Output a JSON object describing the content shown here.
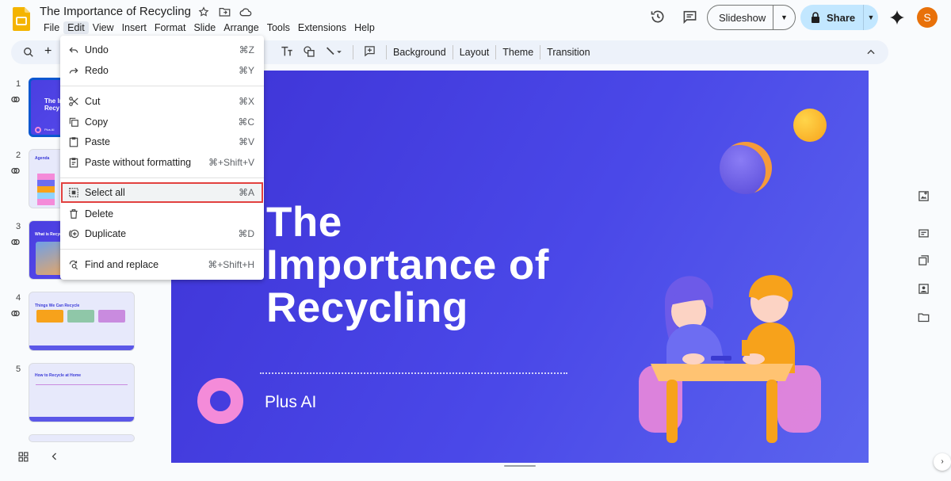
{
  "document": {
    "title": "The Importance of Recycling"
  },
  "menu": [
    "File",
    "Edit",
    "View",
    "Insert",
    "Format",
    "Slide",
    "Arrange",
    "Tools",
    "Extensions",
    "Help"
  ],
  "header": {
    "slideshow_label": "Slideshow",
    "share_label": "Share",
    "avatar_letter": "S"
  },
  "toolbar": {
    "background": "Background",
    "layout": "Layout",
    "theme": "Theme",
    "transition": "Transition"
  },
  "edit_menu": {
    "items": [
      {
        "label": "Undo",
        "shortcut": "⌘Z",
        "icon": "undo-icon"
      },
      {
        "label": "Redo",
        "shortcut": "⌘Y",
        "icon": "redo-icon"
      },
      {
        "label": "Cut",
        "shortcut": "⌘X",
        "icon": "cut-icon"
      },
      {
        "label": "Copy",
        "shortcut": "⌘C",
        "icon": "copy-icon"
      },
      {
        "label": "Paste",
        "shortcut": "⌘V",
        "icon": "paste-icon"
      },
      {
        "label": "Paste without formatting",
        "shortcut": "⌘+Shift+V",
        "icon": "paste-plain-icon"
      },
      {
        "label": "Select all",
        "shortcut": "⌘A",
        "icon": "select-all-icon"
      },
      {
        "label": "Delete",
        "shortcut": "",
        "icon": "trash-icon"
      },
      {
        "label": "Duplicate",
        "shortcut": "⌘D",
        "icon": "duplicate-icon"
      },
      {
        "label": "Find and replace",
        "shortcut": "⌘+Shift+H",
        "icon": "find-replace-icon"
      }
    ]
  },
  "filmstrip": {
    "slides": [
      {
        "number": "1",
        "title": "The Impo Recy",
        "sub": "Plus AI"
      },
      {
        "number": "2",
        "title": "Agenda"
      },
      {
        "number": "3",
        "title": "What is Recycling?"
      },
      {
        "number": "4",
        "title": "Things We Can Recycle"
      },
      {
        "number": "5",
        "title": "How to Recycle at Home"
      }
    ]
  },
  "slide": {
    "title_lines": [
      "The",
      "Importance of",
      "Recycling"
    ],
    "subtitle": "Plus AI"
  },
  "colors": {
    "accent": "#0b57d0",
    "share_bg": "#c2e7ff",
    "slide_bg": "#4a48e8",
    "highlight_border": "#e2413f",
    "avatar": "#e8710a"
  }
}
